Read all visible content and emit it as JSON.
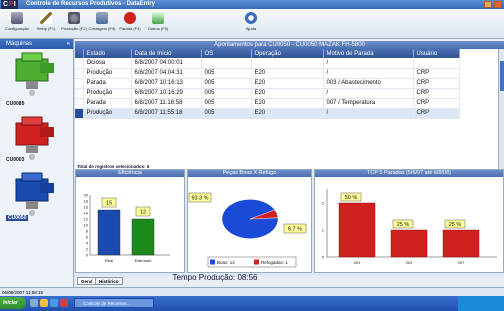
{
  "window": {
    "logo_c": "C",
    "logo_p": "P",
    "logo_i": "I",
    "title": "Controle de Recursos Produtivos - DataEntry"
  },
  "toolbar": {
    "items": [
      {
        "label": "Configuração",
        "icon": "wrench-icon",
        "color": "#6a7aa0"
      },
      {
        "label": "Setup (F1)",
        "icon": "pencil-icon",
        "color": "#8a6a2a"
      },
      {
        "label": "Produção (F2)",
        "icon": "gears-icon",
        "color": "#5a6a80"
      },
      {
        "label": "Contagem (F3)",
        "icon": "counter-icon",
        "color": "#4a6aa0"
      },
      {
        "label": "Parada (F4)",
        "icon": "stop-icon",
        "color": "#d02020"
      },
      {
        "label": "Outros (F5)",
        "icon": "document-icon",
        "color": "#4aa04a"
      },
      {
        "label": "Ajuda",
        "icon": "info-icon",
        "color": "#3a6ac0"
      }
    ]
  },
  "sidebar": {
    "title": "Máquinas",
    "machines": [
      {
        "label": "CU0085",
        "color": "#4caf30"
      },
      {
        "label": "CU0003",
        "color": "#d02020"
      },
      {
        "label": "CU0050",
        "color": "#1a4ab0",
        "selected": true
      }
    ]
  },
  "grid": {
    "title": "Apontamentos para CU0050 - CU0050 MAZAK FH-5800",
    "columns": [
      "Estado",
      "Data de Início",
      "OS",
      "Operação",
      "Motivo de Parada",
      "Usuário"
    ],
    "rows": [
      [
        "Ociosa",
        "6/8/2007 04:00:01",
        "",
        "",
        "/",
        ""
      ],
      [
        "Produção",
        "6/8/2007 04:04:31",
        "005",
        "E20",
        "/",
        "CRP"
      ],
      [
        "Parada",
        "6/8/2007 10:16:13",
        "005",
        "E20",
        "003 / Abastecimento",
        "CRP"
      ],
      [
        "Produção",
        "6/8/2007 10:16:29",
        "005",
        "E20",
        "/",
        "CRP"
      ],
      [
        "Parada",
        "6/8/2007 11:16:58",
        "005",
        "E20",
        "007 / Temperatura",
        "CRP"
      ],
      [
        "Produção",
        "6/8/2007 11:55:18",
        "005",
        "E20",
        "/",
        "CRP"
      ]
    ],
    "total": "Total de registros selecionados: 6"
  },
  "panels": {
    "eficiencia": {
      "title": "Eficiência"
    },
    "pecas": {
      "title": "Peças Boas X Refugo"
    },
    "tcp": {
      "title": "TCP 5 Paradas (5/6/07 até 6/8/08)"
    }
  },
  "chart_data": [
    {
      "type": "bar",
      "title": "Eficiência",
      "categories": [
        "Real",
        "Estimado"
      ],
      "values": [
        15,
        12
      ],
      "data_labels": [
        "15",
        "12"
      ],
      "colors": [
        "#1a4ab0",
        "#1a8a1a"
      ],
      "ylim": [
        0,
        20
      ],
      "yticks": [
        "20",
        "18",
        "16",
        "14",
        "12",
        "10",
        "8",
        "6",
        "4",
        "2",
        "0"
      ],
      "grid": false
    },
    {
      "type": "pie",
      "title": "Peças Boas X Refugo",
      "categories": [
        "Boas: 14",
        "Refugadas: 1"
      ],
      "values": [
        14,
        1
      ],
      "data_labels": [
        "93.3 %",
        "6.7 %"
      ],
      "colors": [
        "#1a4ad8",
        "#d02020"
      ],
      "legend": "bottom"
    },
    {
      "type": "bar",
      "title": "TCP 5 Paradas (5/6/07 até 6/8/08)",
      "categories": [
        "003",
        "002",
        "007"
      ],
      "values": [
        50,
        25,
        25
      ],
      "data_labels": [
        "50 %",
        "25 %",
        "25 %"
      ],
      "colors": [
        "#d02020",
        "#d02020",
        "#d02020"
      ],
      "ylim": [
        0,
        2
      ],
      "yticks": [
        "2",
        "1",
        "0"
      ],
      "grid": false
    }
  ],
  "footer": {
    "tempo": "Tempo Produção: 08:56",
    "tabs": [
      "Geral",
      "Histórico"
    ]
  },
  "statusbar": {
    "datetime": "06/08/2007 11:58:19"
  },
  "taskbar": {
    "start": "Iniciar",
    "task": "Controle de Recursos..."
  }
}
